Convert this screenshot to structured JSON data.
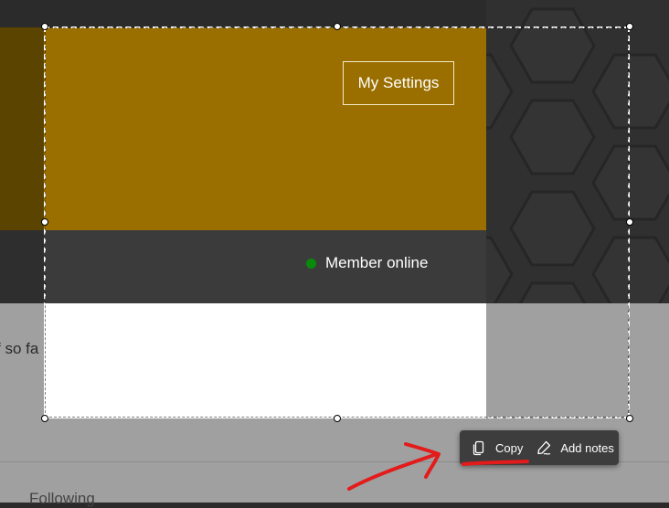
{
  "header": {
    "settings_button_label": "My Settings"
  },
  "status": {
    "label": "Member online",
    "dot_color": "#0a8a0a"
  },
  "background": {
    "cut_text": "f so fa",
    "following_label": "Following"
  },
  "snip_toolbar": {
    "copy_label": "Copy",
    "copy_icon": "copy-icon",
    "notes_label": "Add notes",
    "notes_icon": "pen-icon"
  },
  "colors": {
    "banner_gold": "#9a6f00",
    "status_bar": "#3b3b3b",
    "annotation_red": "#e31b1b"
  }
}
